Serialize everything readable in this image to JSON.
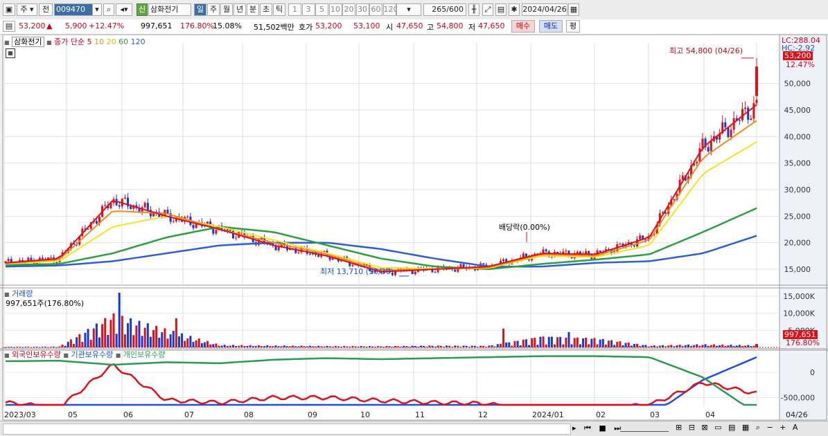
{
  "toolbar": {
    "market_label": "주",
    "prev_label": "전",
    "code": "009470",
    "new_badge": "신",
    "stock_name": "삼화전기",
    "period_tabs": [
      "일",
      "주",
      "월",
      "년",
      "분",
      "초",
      "틱"
    ],
    "minute_buttons": [
      "1",
      "3",
      "5",
      "10",
      "20",
      "30",
      "60",
      "120"
    ],
    "count_value": "265",
    "count_max": "/600",
    "date": "2024/04/26"
  },
  "quote": {
    "price": "53,200",
    "change": "5,900",
    "change_pct": "+12.47%",
    "volume": "997,651",
    "volume_pct": "176.80%",
    "turnover": "15.08%",
    "amount": "51,502백만",
    "ask_label": "호가",
    "ask1": "53,200",
    "ask2": "53,100",
    "open_label": "시",
    "open": "47,650",
    "high_label": "고",
    "high": "54,800",
    "low_label": "저",
    "low": "47,650",
    "buy_label": "매수",
    "sell_label": "매도",
    "eval_label": "평"
  },
  "price_pane": {
    "name": "삼화전기",
    "ma_label": "종가 단순 5",
    "ma_periods": [
      "10",
      "20",
      "60",
      "120"
    ],
    "lc": "LC:288.04",
    "hc": "HC:-2.92",
    "current_tag": "53,200",
    "pct_tag": "12.47%",
    "annot_high": "최고 54,800 (04/26)",
    "annot_low": "최저 13,710 (10/30)",
    "annot_div": "배당락(0.00%)"
  },
  "volume_pane": {
    "name": "거래량",
    "info": "997,651주(176.80%)",
    "tag_value": "997,651",
    "tag_pct": "176.80%"
  },
  "holding_pane": {
    "names": [
      "외국인보유수량",
      "기관보유수량",
      "개인보유수량"
    ]
  },
  "colors": {
    "up": "#e0101a",
    "down": "#1538d8",
    "ma5": "#e0101a",
    "ma10": "#f08c1e",
    "ma20": "#f5e51c",
    "ma60": "#2aa040",
    "ma120": "#2c5fd6",
    "foreign": "#1e4fe0",
    "institution": "#e0101a",
    "individual": "#2a9a55"
  },
  "chart_data": [
    {
      "type": "candlestick",
      "title": "삼화전기",
      "y_ticks": [
        "15,000",
        "20,000",
        "25,000",
        "30,000",
        "35,000",
        "40,000",
        "45,000",
        "50,000"
      ],
      "ylim": [
        12000,
        57000
      ],
      "x_ticks": [
        "2023/03",
        "05",
        "06",
        "07",
        "08",
        "09",
        "10",
        "11",
        "12",
        "2024/01",
        "02",
        "03",
        "04",
        "04/26"
      ],
      "x": [
        "2023-03",
        "2023-04",
        "2023-05",
        "2023-06",
        "2023-07",
        "2023-08",
        "2023-09",
        "2023-10",
        "2023-11",
        "2023-12",
        "2024-01",
        "2024-02",
        "2024-03",
        "2024-04",
        "2024-04-26"
      ],
      "series": [
        {
          "name": "5",
          "values": [
            16200,
            17000,
            28000,
            25000,
            22500,
            19500,
            17500,
            14500,
            15000,
            15500,
            18000,
            17800,
            21000,
            38000,
            46000
          ]
        },
        {
          "name": "10",
          "values": [
            16100,
            16800,
            26000,
            25500,
            22500,
            20000,
            17800,
            14800,
            15000,
            15300,
            17800,
            17500,
            20500,
            36000,
            43000
          ]
        },
        {
          "name": "20",
          "values": [
            16000,
            16500,
            23000,
            25000,
            23000,
            20500,
            18000,
            15300,
            15100,
            15200,
            17500,
            17300,
            19500,
            33000,
            39000
          ]
        },
        {
          "name": "60",
          "values": [
            15800,
            16000,
            18000,
            21000,
            23000,
            22000,
            19500,
            17000,
            15500,
            15000,
            16000,
            16800,
            17800,
            22000,
            26500
          ]
        },
        {
          "name": "120",
          "values": [
            15500,
            15700,
            16500,
            18000,
            19500,
            20000,
            20000,
            18800,
            17000,
            15500,
            15500,
            16200,
            16500,
            18000,
            21300
          ]
        }
      ],
      "high": 54800,
      "low": 13710,
      "last_close": 53200
    },
    {
      "type": "bar",
      "title": "거래량",
      "y_ticks": [
        "5,000K",
        "10,000K",
        "15,000K"
      ],
      "ylim": [
        0,
        17000
      ],
      "x": [
        "2023-03",
        "2023-04",
        "2023-05",
        "2023-06",
        "2023-07",
        "2023-08",
        "2023-09",
        "2023-10",
        "2023-11",
        "2023-12",
        "2024-01",
        "2024-02",
        "2024-03",
        "2024-04",
        "2024-04-26"
      ],
      "values": [
        300,
        400,
        16000,
        8500,
        1200,
        900,
        700,
        600,
        900,
        800,
        5500,
        4500,
        900,
        1500,
        997.651
      ]
    },
    {
      "type": "line",
      "title": "외국인보유수량 / 기관보유수량 / 개인보유수량",
      "y_ticks": [
        "0",
        "-500,000"
      ],
      "x": [
        "2023-03",
        "2023-04",
        "2023-05",
        "2023-06",
        "2023-07",
        "2023-08",
        "2023-09",
        "2023-10",
        "2023-11",
        "2023-12",
        "2024-01",
        "2024-02",
        "2024-03",
        "2024-04",
        "2024-04-26"
      ],
      "series": [
        {
          "name": "외국인보유수량",
          "values": [
            -880000,
            -900000,
            -920000,
            -930000,
            -930000,
            -930000,
            -930000,
            -930000,
            -930000,
            -930000,
            -930000,
            -920000,
            -880000,
            -150000,
            300000
          ]
        },
        {
          "name": "기관보유수량",
          "values": [
            -600000,
            -700000,
            150000,
            -550000,
            -600000,
            -500000,
            -500000,
            -560000,
            -600000,
            -620000,
            -820000,
            -700000,
            -650000,
            -200000,
            -420000
          ]
        },
        {
          "name": "개인보유수량",
          "values": [
            220000,
            230000,
            150000,
            200000,
            180000,
            250000,
            280000,
            260000,
            280000,
            300000,
            320000,
            320000,
            300000,
            -100000,
            -820000
          ]
        }
      ]
    }
  ]
}
